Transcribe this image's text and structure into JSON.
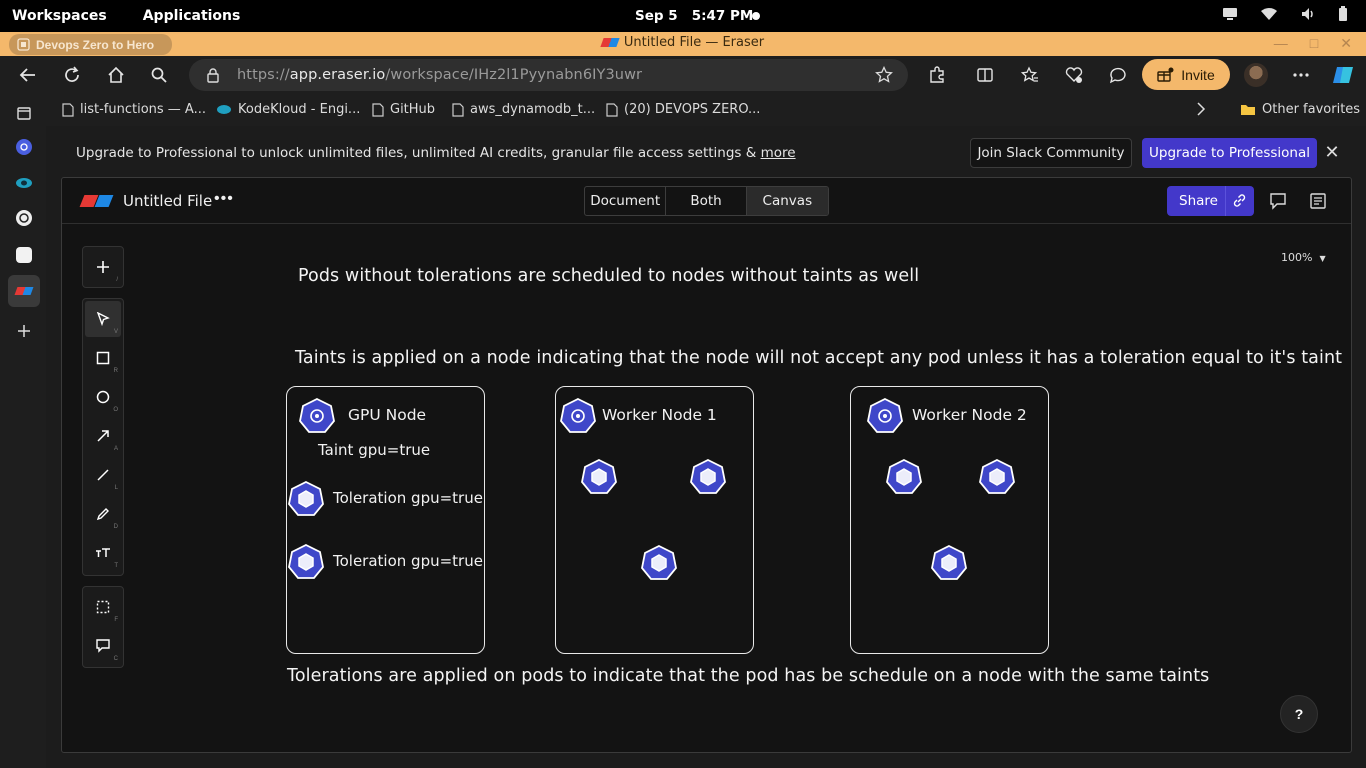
{
  "system_bar": {
    "workspaces": "Workspaces",
    "applications": "Applications",
    "date": "Sep 5",
    "time": "5:47 PM"
  },
  "browser": {
    "profile": "Devops Zero to Hero",
    "window_title": "Untitled File — Eraser",
    "url_prefix": "https://",
    "url_host": "app.eraser.io",
    "url_path": "/workspace/IHz2l1Pyynabn6IY3uwr",
    "invite_label": "Invite",
    "bookmarks": [
      {
        "label": "list-functions — A..."
      },
      {
        "label": "KodeKloud - Engi..."
      },
      {
        "label": "GitHub"
      },
      {
        "label": "aws_dynamodb_t..."
      },
      {
        "label": "(20) DEVOPS ZERO..."
      }
    ],
    "other_favorites": "Other favorites"
  },
  "banner": {
    "text": "Upgrade to Professional to unlock unlimited files, unlimited AI credits, granular file access settings & ",
    "more_link": "more",
    "slack_button": "Join Slack Community",
    "upgrade_button": "Upgrade to Professional"
  },
  "eraser": {
    "file_name": "Untitled File",
    "view_modes": [
      "Document",
      "Both",
      "Canvas"
    ],
    "active_view": "Canvas",
    "share_label": "Share",
    "zoom": "100%",
    "help": "?",
    "tool_keys": [
      "/",
      "V",
      "R",
      "O",
      "A",
      "L",
      "D",
      "T",
      "F",
      "C"
    ]
  },
  "canvas": {
    "note_top": "Pods without tolerations are scheduled to nodes without taints as well",
    "note_taints": "Taints is applied on a node indicating that the node will not accept any pod unless it has a toleration equal to it's taint",
    "note_tolerations": "Tolerations are applied on pods to indicate that the pod has be schedule on a node with the same taints",
    "nodes": [
      {
        "title": "GPU Node",
        "taint_label": "Taint  gpu=true",
        "tolerations": [
          "Toleration  gpu=true",
          "Toleration  gpu=true"
        ]
      },
      {
        "title": "Worker Node 1",
        "pods": 3
      },
      {
        "title": "Worker Node 2",
        "pods": 3
      }
    ],
    "colors": {
      "k8s_fill": "#3f47c9",
      "k8s_border": "#ffffff",
      "box_stroke": "#e9e9e9",
      "accent": "#4338ca",
      "browser_accent": "#f4b86b"
    }
  }
}
